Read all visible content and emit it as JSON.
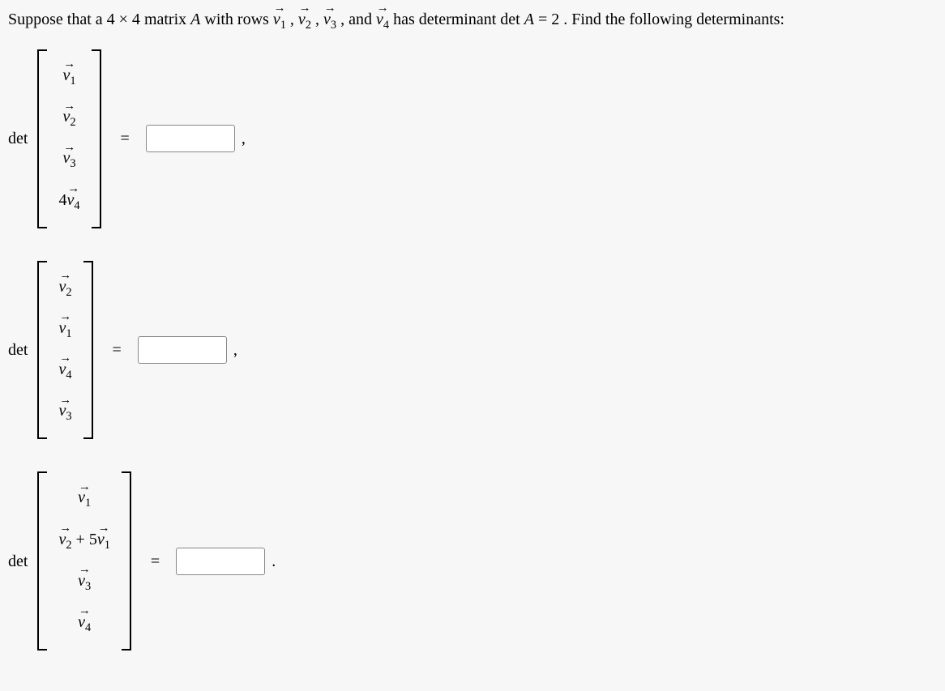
{
  "prompt": {
    "prefix": "Suppose that a ",
    "dim": "4 × 4",
    "mid1": " matrix ",
    "A": "A",
    "mid2": " with rows ",
    "v1": "v",
    "v1_sub": "1",
    "sep1": ", ",
    "v2": "v",
    "v2_sub": "2",
    "sep2": ", ",
    "v3": "v",
    "v3_sub": "3",
    "sep3": ", and ",
    "v4": "v",
    "v4_sub": "4",
    "mid3": " has determinant ",
    "detA": "det",
    "A2": "A",
    "eq": " = ",
    "val": "2",
    "suffix": ". Find the following determinants:"
  },
  "matrices": {
    "m1": {
      "r1_v": "v",
      "r1_sub": "1",
      "r2_v": "v",
      "r2_sub": "2",
      "r3_v": "v",
      "r3_sub": "3",
      "r4_coef": "4",
      "r4_v": "v",
      "r4_sub": "4"
    },
    "m2": {
      "r1_v": "v",
      "r1_sub": "2",
      "r2_v": "v",
      "r2_sub": "1",
      "r3_v": "v",
      "r3_sub": "4",
      "r4_v": "v",
      "r4_sub": "3"
    },
    "m3": {
      "r1_v": "v",
      "r1_sub": "1",
      "r2_va": "v",
      "r2_sa": "2",
      "r2_plus": " + ",
      "r2_coef": "5",
      "r2_vb": "v",
      "r2_sb": "1",
      "r3_v": "v",
      "r3_sub": "3",
      "r4_v": "v",
      "r4_sub": "4"
    }
  },
  "labels": {
    "det": "det",
    "equals": "=",
    "comma": ",",
    "period": "."
  },
  "answers": {
    "a1": "",
    "a2": "",
    "a3": ""
  },
  "chart_data": {
    "type": "table",
    "description": "Determinant problems based on 4x4 matrix A with det A = 2",
    "given_determinant": 2,
    "problems": [
      {
        "rows": [
          "v1",
          "v2",
          "v3",
          "4*v4"
        ]
      },
      {
        "rows": [
          "v2",
          "v1",
          "v4",
          "v3"
        ]
      },
      {
        "rows": [
          "v1",
          "v2 + 5*v1",
          "v3",
          "v4"
        ]
      }
    ]
  }
}
